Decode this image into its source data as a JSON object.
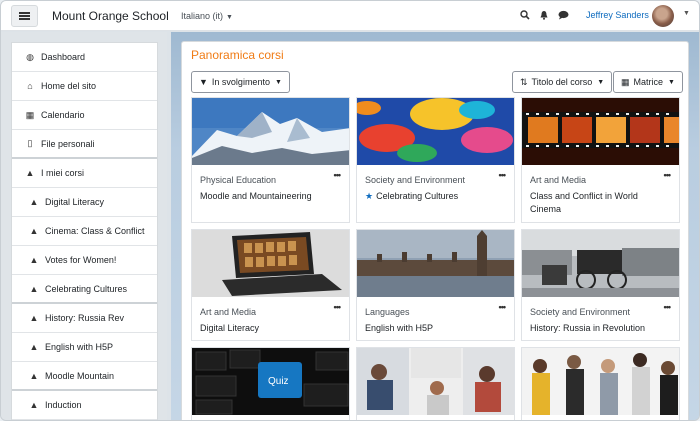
{
  "header": {
    "site_name": "Mount Orange School",
    "language": "Italiano (it)",
    "user_name": "Jeffrey Sanders"
  },
  "drawer": {
    "items": [
      {
        "icon": "dashboard-icon",
        "label": "Dashboard"
      },
      {
        "icon": "home-icon",
        "label": "Home del sito"
      },
      {
        "icon": "calendar-icon",
        "label": "Calendario"
      },
      {
        "icon": "file-icon",
        "label": "File personali"
      },
      {
        "icon": "graduation-cap-icon",
        "label": "I miei corsi"
      },
      {
        "icon": "graduation-cap-icon",
        "label": "Digital Literacy"
      },
      {
        "icon": "graduation-cap-icon",
        "label": "Cinema: Class & Conflict"
      },
      {
        "icon": "graduation-cap-icon",
        "label": "Votes for Women!"
      },
      {
        "icon": "graduation-cap-icon",
        "label": "Celebrating Cultures"
      },
      {
        "icon": "graduation-cap-icon",
        "label": "History: Russia Rev"
      },
      {
        "icon": "graduation-cap-icon",
        "label": "English with H5P"
      },
      {
        "icon": "graduation-cap-icon",
        "label": "Moodle Mountain"
      },
      {
        "icon": "graduation-cap-icon",
        "label": "Induction"
      }
    ]
  },
  "main": {
    "title": "Panoramica corsi",
    "filter_label": "In svolgimento",
    "sort_label": "Titolo del corso",
    "view_label": "Matrice"
  },
  "courses": [
    {
      "category": "Physical Education",
      "name": "Moodle and Mountaineering",
      "starred": false,
      "image": "mountain"
    },
    {
      "category": "Society and Environment",
      "name": "Celebrating Cultures",
      "starred": true,
      "image": "umbrellas"
    },
    {
      "category": "Art and Media",
      "name": "Class and Conflict in World Cinema",
      "starred": false,
      "image": "film"
    },
    {
      "category": "Art and Media",
      "name": "Digital Literacy",
      "starred": false,
      "image": "laptop"
    },
    {
      "category": "Languages",
      "name": "English with H5P",
      "starred": false,
      "image": "parliament"
    },
    {
      "category": "Society and Environment",
      "name": "History: Russia in Revolution",
      "starred": false,
      "image": "carriage"
    },
    {
      "category": "",
      "name": "",
      "starred": false,
      "image": "keyboard",
      "image_text": "Quiz"
    },
    {
      "category": "",
      "name": "",
      "starred": false,
      "image": "people"
    },
    {
      "category": "",
      "name": "",
      "starred": false,
      "image": "crowd"
    }
  ]
}
